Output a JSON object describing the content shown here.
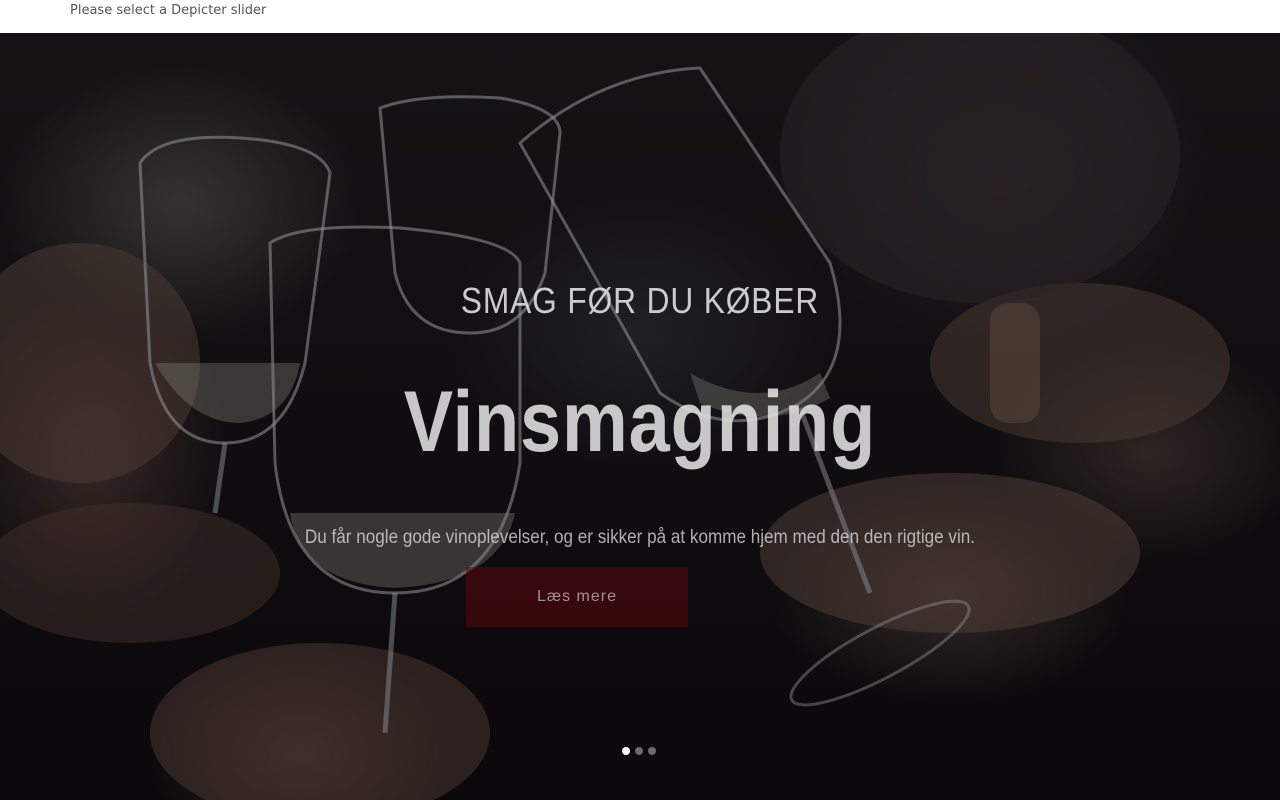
{
  "notice": {
    "text": "Please select a Depicter slider"
  },
  "slider": {
    "eyebrow": "SMAG FØR DU KØBER",
    "headline": "Vinsmagning",
    "subline": "Du får nogle gode vinoplevelser, og er sikker på at komme hjem med den den rigtige vin.",
    "button_label": "Læs mere",
    "active_slide": 1,
    "slide_count": 3
  },
  "colors": {
    "button_bg": "#5a080c",
    "overlay": "#0a060a",
    "dot_active": "#ffffff",
    "dot_inactive": "#a0a0a0"
  }
}
